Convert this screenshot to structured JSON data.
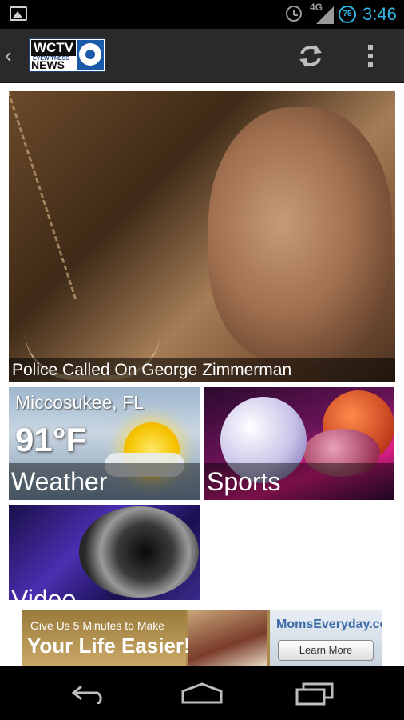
{
  "status_bar": {
    "time": "3:46",
    "network": "4G",
    "battery_level": "75"
  },
  "action_bar": {
    "logo": {
      "line1": "WCTV",
      "line2": "EYEWITNESS",
      "line3": "NEWS"
    }
  },
  "hero": {
    "caption": "Police Called On George Zimmerman"
  },
  "weather": {
    "location": "Miccosukee, FL",
    "temperature": "91°F",
    "label": "Weather"
  },
  "sports": {
    "label": "Sports"
  },
  "video": {
    "label": "Video"
  },
  "ad": {
    "line1": "Give Us 5 Minutes to Make",
    "line2": "Your Life Easier!",
    "brand": "MomsEveryday.com",
    "button": "Learn More"
  },
  "icons": {
    "status": [
      "image-icon",
      "alarm-icon",
      "signal-icon",
      "battery-icon"
    ],
    "action_bar": [
      "back-icon",
      "refresh-icon",
      "overflow-menu-icon"
    ],
    "nav_bar": [
      "back-nav-icon",
      "home-nav-icon",
      "recent-apps-icon"
    ]
  }
}
